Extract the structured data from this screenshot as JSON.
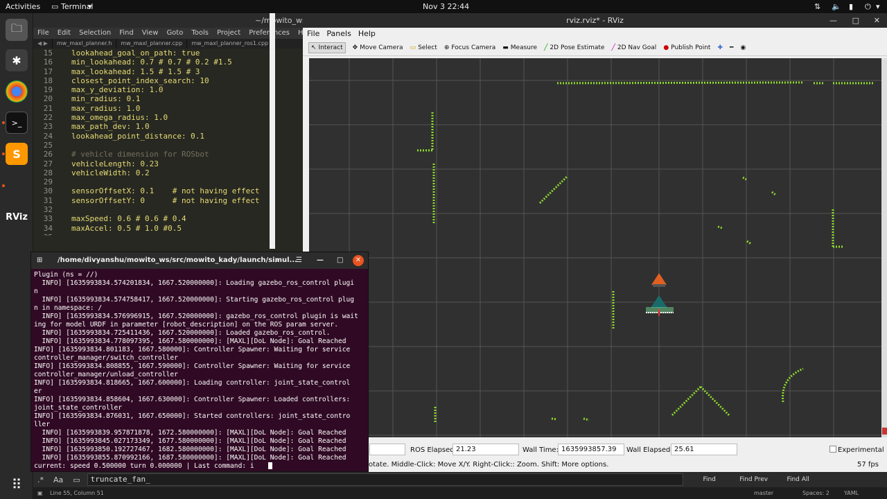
{
  "topbar": {
    "activities": "Activities",
    "app": "Terminal",
    "clock": "Nov 3  22:44"
  },
  "editor": {
    "title": "~/mowito_ws/s",
    "menu": [
      "File",
      "Edit",
      "Selection",
      "Find",
      "View",
      "Goto",
      "Tools",
      "Project",
      "Preferences",
      "Help"
    ],
    "tabs": [
      "mw_maxl_planner.h",
      "mw_maxl_planner.cpp",
      "mw_maxl_planner_ros1.cpp"
    ],
    "lines": [
      {
        "n": "15",
        "text": "lookahead_goal_on_path: true"
      },
      {
        "n": "16",
        "text": "min_lookahead: 0.7 # 0.7 # 0.2 #1.5"
      },
      {
        "n": "17",
        "text": "max_lookahead: 1.5 # 1.5 # 3"
      },
      {
        "n": "18",
        "text": "closest_point_index_search: 10"
      },
      {
        "n": "19",
        "text": "max_y_deviation: 1.0"
      },
      {
        "n": "20",
        "text": "min_radius: 0.1"
      },
      {
        "n": "21",
        "text": "max_radius: 1.0"
      },
      {
        "n": "22",
        "text": "max_omega_radius: 1.0"
      },
      {
        "n": "23",
        "text": "max_path_dev: 1.0"
      },
      {
        "n": "24",
        "text": "lookahead_point_distance: 0.1"
      },
      {
        "n": "25",
        "text": ""
      },
      {
        "n": "26",
        "text": "# vehicle dimension for ROSbot"
      },
      {
        "n": "27",
        "text": "vehicleLength: 0.23"
      },
      {
        "n": "28",
        "text": "vehicleWidth: 0.2"
      },
      {
        "n": "29",
        "text": ""
      },
      {
        "n": "30",
        "text": "sensorOffsetX: 0.1    # not having effect"
      },
      {
        "n": "31",
        "text": "sensorOffsetY: 0      # not having effect"
      },
      {
        "n": "32",
        "text": ""
      },
      {
        "n": "33",
        "text": "maxSpeed: 0.6 # 0.6 # 0.4"
      },
      {
        "n": "34",
        "text": "maxAccel: 0.5 # 1.0 #0.5"
      },
      {
        "n": "35",
        "text": ""
      }
    ]
  },
  "rviz": {
    "title": "rviz.rviz* - RViz",
    "menu": [
      "File",
      "Panels",
      "Help"
    ],
    "tools": [
      "Interact",
      "Move Camera",
      "Select",
      "Focus Camera",
      "Measure",
      "2D Pose Estimate",
      "2D Nav Goal",
      "Publish Point"
    ],
    "status": {
      "ros_elapsed_label": "ROS Elapsed:",
      "ros_elapsed": "21.23",
      "wall_time_label": "Wall Time:",
      "wall_time": "1635993857.39",
      "wall_elapsed_label": "Wall Elapsed:",
      "wall_elapsed": "25.61",
      "experimental": "Experimental",
      "hint_tail": "otate. Middle-Click: Move X/Y. Right-Click:: Zoom. Shift: More options.",
      "fps": "57 fps"
    }
  },
  "terminal": {
    "title": "/home/divyanshu/mowito_ws/src/mowito_kady/launch/simul...",
    "lines": [
      "Plugin (ns = //)",
      "  INFO] [1635993834.574201834, 1667.520000000]: Loading gazebo_ros_control plugi",
      "n",
      "  INFO] [1635993834.574758417, 1667.520000000]: Starting gazebo_ros_control plug",
      "n in namespace: /",
      "  INFO] [1635993834.576996915, 1667.520000000]: gazebo_ros_control plugin is wait",
      "ing for model URDF in parameter [robot_description] on the ROS param server.",
      "  INFO] [1635993834.725411436, 1667.520000000]: Loaded gazebo_ros_control.",
      "  INFO] [1635993834.778097395, 1667.580000000]: [MAXL][DoL Node]: Goal Reached",
      "INFO] [1635993834.801183, 1667.580000]: Controller Spawner: Waiting for service",
      "controller_manager/switch_controller",
      "INFO] [1635993834.808855, 1667.590000]: Controller Spawner: Waiting for service",
      "controller_manager/unload_controller",
      "INFO] [1635993834.818665, 1667.600000]: Loading controller: joint_state_control",
      "er",
      "INFO] [1635993834.858604, 1667.630000]: Controller Spawner: Loaded controllers:",
      "joint_state_controller",
      "INFO] [1635993834.876031, 1667.650000]: Started controllers: joint_state_contro",
      "ller",
      "  INFO] [1635993839.957871878, 1672.580000000]: [MAXL][DoL Node]: Goal Reached",
      "  INFO] [1635993845.027173349, 1677.580000000]: [MAXL][DoL Node]: Goal Reached",
      "  INFO] [1635993850.192727467, 1682.580000000]: [MAXL][DoL Node]: Goal Reached",
      "  INFO] [1635993855.870992166, 1687.580000000]: [MAXL][DoL Node]: Goal Reached",
      "current: speed 0.500000 turn 0.000000 | Last command: i"
    ]
  },
  "bottom": {
    "find_aa": "Aa",
    "find_text": "truncate_fan_",
    "find_btn": "Find",
    "find_prev": "Find Prev",
    "find_all": "Find All",
    "status_left": "Line 55, Column 51",
    "git": "master",
    "spaces": "Spaces: 2",
    "syntax": "YAML"
  }
}
